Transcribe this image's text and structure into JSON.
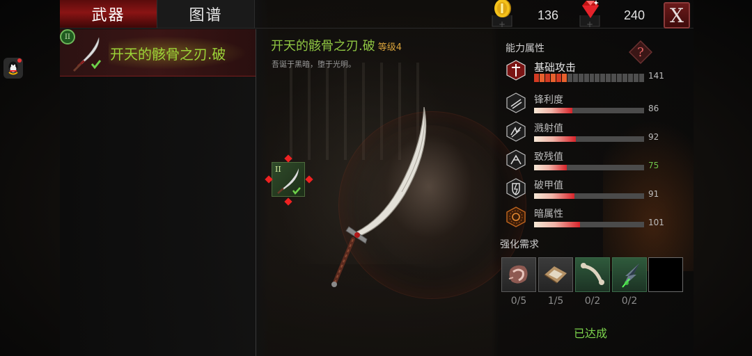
{
  "tabs": [
    {
      "label": "武器",
      "active": true
    },
    {
      "label": "图谱",
      "active": false
    }
  ],
  "currency": {
    "gold": {
      "icon": "gold-coin-icon",
      "value": "136"
    },
    "gem": {
      "icon": "red-gem-icon",
      "value": "240"
    }
  },
  "close_label": "X",
  "weapon_list": [
    {
      "name": "开天的骸骨之刃.破",
      "tier": "II",
      "equipped": true
    }
  ],
  "detail": {
    "name": "开天的骸骨之刃.破",
    "level": "等级4",
    "description": "吾诞于黑暗，堕于光明。",
    "tier": "II"
  },
  "stats": {
    "title": "能力属性",
    "items": [
      {
        "label": "基础攻击",
        "value": "141",
        "fraction": 0.28,
        "icon": "base-attack-icon",
        "style": "segmented"
      },
      {
        "label": "锋利度",
        "value": "86",
        "fraction": 0.35,
        "icon": "sharpness-icon"
      },
      {
        "label": "溅射值",
        "value": "92",
        "fraction": 0.38,
        "icon": "splash-icon"
      },
      {
        "label": "致残值",
        "value": "75",
        "fraction": 0.3,
        "icon": "cripple-icon",
        "highlight": true
      },
      {
        "label": "破甲值",
        "value": "91",
        "fraction": 0.37,
        "icon": "armor-break-icon"
      },
      {
        "label": "暗属性",
        "value": "101",
        "fraction": 0.42,
        "icon": "dark-element-icon"
      }
    ]
  },
  "requirements": {
    "title": "强化需求",
    "slots": [
      {
        "icon": "flesh-material-icon",
        "count": "0/5"
      },
      {
        "icon": "parchment-material-icon",
        "count": "1/5"
      },
      {
        "icon": "bone-material-icon",
        "count": "0/2"
      },
      {
        "icon": "dark-crystal-material-icon",
        "count": "0/2"
      },
      {
        "icon": "",
        "count": ""
      }
    ],
    "status": "已达成"
  },
  "colors": {
    "accent_red": "#8a1414",
    "name_green": "#9cd338",
    "level_gold": "#d7a23b",
    "status_green": "#7cd44c"
  }
}
